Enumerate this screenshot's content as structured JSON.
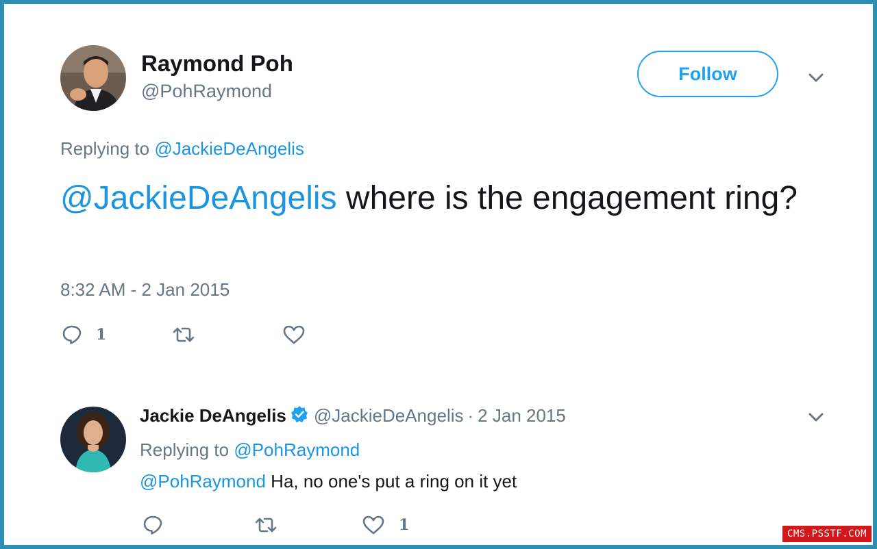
{
  "main_tweet": {
    "author_name": "Raymond Poh",
    "author_handle": "@PohRaymond",
    "follow_label": "Follow",
    "replying_prefix": "Replying to ",
    "replying_to": "@JackieDeAngelis",
    "mention": "@JackieDeAngelis",
    "text": " where is the engagement ring?",
    "timestamp": "8:32 AM - 2 Jan 2015",
    "reply_count": "1",
    "retweet_count": "",
    "like_count": ""
  },
  "reply_tweet": {
    "author_name": "Jackie DeAngelis",
    "verified": true,
    "author_handle": "@JackieDeAngelis",
    "separator": "·",
    "date": "2 Jan 2015",
    "replying_prefix": "Replying to ",
    "replying_to": "@PohRaymond",
    "mention": "@PohRaymond",
    "text": " Ha, no one's put a ring on it yet",
    "reply_count": "",
    "retweet_count": "",
    "like_count": "1"
  },
  "watermark": "CMS.PSSTF.COM",
  "colors": {
    "link": "#1b95e0",
    "follow_border": "#1da1f2",
    "secondary_text": "#657786",
    "primary_text": "#14171a",
    "frame": "#2f8fb3",
    "watermark_bg": "#d3171b"
  },
  "icons": {
    "reply": "reply-bubble-icon",
    "retweet": "retweet-icon",
    "like": "heart-icon",
    "menu": "chevron-down-icon",
    "verified": "verified-badge-icon"
  }
}
